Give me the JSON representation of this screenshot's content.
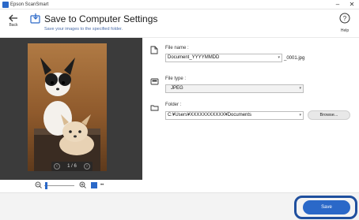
{
  "window": {
    "app_title": "Epson ScanSmart",
    "minimize_icon": "minimize-icon",
    "close_icon": "close-icon"
  },
  "header": {
    "back_label": "Back",
    "title": "Save to Computer Settings",
    "subtitle": "Save your images to the specified folder.",
    "help_label": "Help"
  },
  "preview": {
    "page_current": "1",
    "page_separator": "/",
    "page_total": "6",
    "prev_icon": "chevron-left-icon",
    "next_icon": "chevron-right-icon"
  },
  "zoom": {
    "zoom_out_icon": "zoom-out-icon",
    "zoom_in_icon": "zoom-in-icon",
    "fit_icon": "fit-page-icon",
    "more_label": "••"
  },
  "settings": {
    "file_name": {
      "label": "File name :",
      "value": "Document_YYYYMMDD",
      "suffix": "_0001.jpg"
    },
    "file_type": {
      "label": "File type :",
      "value": "JPEG"
    },
    "folder": {
      "label": "Folder :",
      "value": "C:¥Users¥XXXXXXXXXXX¥Documents",
      "browse_label": "Browse..."
    }
  },
  "footer": {
    "save_label": "Save"
  },
  "colors": {
    "accent": "#2a68c8",
    "highlight_ring": "#1f4f9e",
    "preview_bg": "#3b3b3b"
  }
}
